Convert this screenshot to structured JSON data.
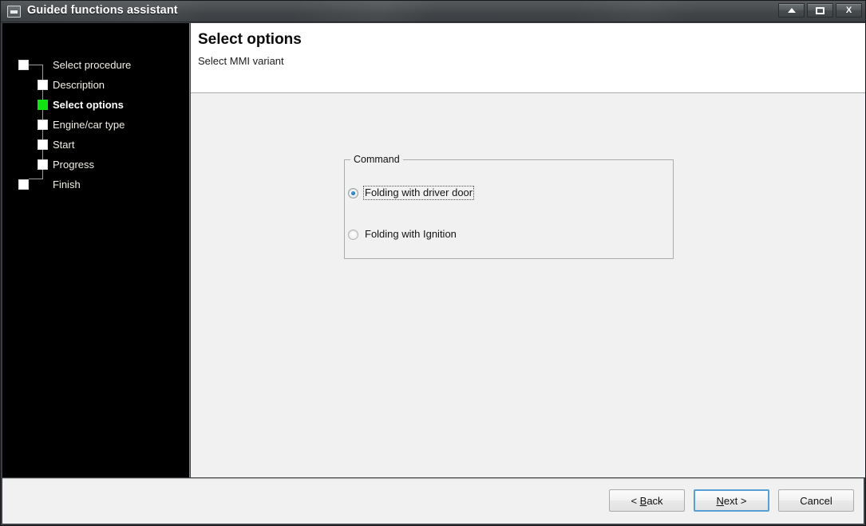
{
  "window": {
    "title": "Guided functions assistant",
    "icon": "window-restore-icon",
    "controls": [
      {
        "name": "minimize-button",
        "glyph": "triangle-up"
      },
      {
        "name": "maximize-button",
        "glyph": "square"
      },
      {
        "name": "close-button",
        "glyph": "X"
      }
    ],
    "close_label": "X"
  },
  "sidebar": {
    "steps": [
      {
        "label": "Select procedure",
        "state": "pending",
        "indent": "outer"
      },
      {
        "label": "Description",
        "state": "pending",
        "indent": "inner"
      },
      {
        "label": "Select options",
        "state": "current",
        "indent": "inner"
      },
      {
        "label": "Engine/car type",
        "state": "pending",
        "indent": "inner"
      },
      {
        "label": "Start",
        "state": "pending",
        "indent": "inner"
      },
      {
        "label": "Progress",
        "state": "pending",
        "indent": "inner"
      },
      {
        "label": "Finish",
        "state": "pending",
        "indent": "outer"
      }
    ],
    "current_color": "#12e212"
  },
  "header": {
    "title": "Select options",
    "subtitle": "Select MMI variant"
  },
  "main": {
    "group": {
      "legend": "Command",
      "options": [
        {
          "label": "Folding with driver door",
          "checked": true,
          "focused": true
        },
        {
          "label": "Folding with Ignition",
          "checked": false,
          "focused": false
        }
      ]
    }
  },
  "footer": {
    "buttons": [
      {
        "name": "back-button",
        "prefix": "< ",
        "accel": "B",
        "suffix": "ack",
        "default": false
      },
      {
        "name": "next-button",
        "prefix": "",
        "accel": "N",
        "suffix": "ext >",
        "default": true
      },
      {
        "name": "cancel-button",
        "prefix": "",
        "accel": "",
        "suffix": "Cancel",
        "default": false
      }
    ]
  }
}
